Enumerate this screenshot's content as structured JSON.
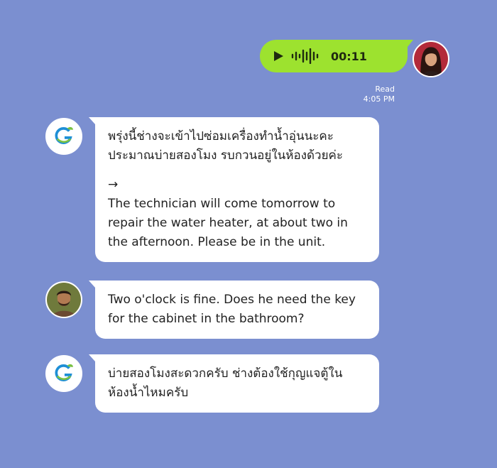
{
  "messages": [
    {
      "id": "m1",
      "sender": "self",
      "type": "voice",
      "duration": "00:11",
      "status": "Read",
      "time": "4:05 PM"
    },
    {
      "id": "m2",
      "sender": "property-manager",
      "original": "พรุ่งนี้ช่างจะเข้าไปซ่อมเครื่องทำน้ำอุ่นนะคะ ประมาณบ่ายสองโมง รบกวนอยู่ในห้องด้วยค่ะ",
      "arrow": "→",
      "translation": "The technician will come tomorrow to repair the water heater, at about two in the afternoon. Please be in the unit."
    },
    {
      "id": "m3",
      "sender": "tenant",
      "text": "Two o'clock is fine. Does he need the key for the cabinet in the bathroom?"
    },
    {
      "id": "m4",
      "sender": "property-manager",
      "text": "บ่ายสองโมงสะดวกครับ ช่างต้องใช้กุญแจตู้ในห้องน้ำไหมครับ"
    }
  ],
  "icons": {
    "play": "play-icon",
    "waveform": "waveform-icon",
    "company_logo": "company-logo-icon"
  },
  "colors": {
    "background": "#7b8fd0",
    "voice_bubble": "#9de22f",
    "bubble": "#ffffff"
  }
}
